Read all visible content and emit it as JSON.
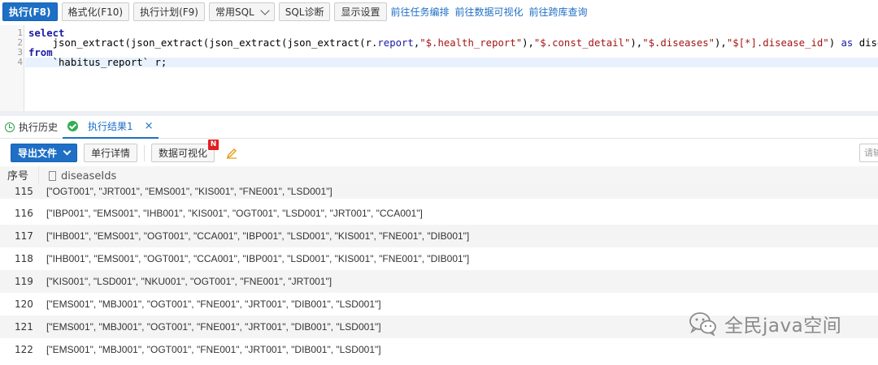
{
  "toolbar": {
    "execute": "执行(F8)",
    "format": "格式化(F10)",
    "plan": "执行计划(F9)",
    "common_sql": "常用SQL",
    "sql_diag": "SQL诊断",
    "display_settings": "显示设置",
    "link_task": "前往任务编排",
    "link_viz": "前往数据可视化",
    "link_cross": "前往跨库查询"
  },
  "editor": {
    "line_numbers": [
      "1",
      "2",
      "3",
      "4"
    ],
    "line1_kw": "select",
    "line2_a": "    json_extract(json_extract(json_extract(json_extract(r.",
    "line2_field": "report",
    "line2_b": ",",
    "line2_s1": "\"$.health_report\"",
    "line2_c": "),",
    "line2_s2": "\"$.const_detail\"",
    "line2_d": "),",
    "line2_s3": "\"$.diseases\"",
    "line2_e": "),",
    "line2_s4": "\"$[*].disease_id\"",
    "line2_f": ") ",
    "line2_as": "as",
    "line2_g": " diseaseIds",
    "line3_kw": "from",
    "line4": "    `habitus_report` r;"
  },
  "tabs": {
    "history": "执行历史",
    "result": "执行结果1",
    "close": "×"
  },
  "result_toolbar": {
    "export": "导出文件",
    "row_detail": "单行详情",
    "data_viz": "数据可视化",
    "new_badge": "N",
    "search_placeholder": "请输"
  },
  "grid": {
    "col_seq": "序号",
    "col_disease": "diseaseIds",
    "rows": [
      {
        "n": "115",
        "v": "[\"OGT001\", \"JRT001\", \"EMS001\", \"KIS001\", \"FNE001\", \"LSD001\"]"
      },
      {
        "n": "116",
        "v": "[\"IBP001\", \"EMS001\", \"IHB001\", \"KIS001\", \"OGT001\", \"LSD001\", \"JRT001\", \"CCA001\"]"
      },
      {
        "n": "117",
        "v": "[\"IHB001\", \"EMS001\", \"OGT001\", \"CCA001\", \"IBP001\", \"LSD001\", \"KIS001\", \"FNE001\", \"DIB001\"]"
      },
      {
        "n": "118",
        "v": "[\"IHB001\", \"EMS001\", \"OGT001\", \"CCA001\", \"IBP001\", \"LSD001\", \"KIS001\", \"FNE001\", \"DIB001\"]"
      },
      {
        "n": "119",
        "v": "[\"KIS001\", \"LSD001\", \"NKU001\", \"OGT001\", \"FNE001\", \"JRT001\"]"
      },
      {
        "n": "120",
        "v": "[\"EMS001\", \"MBJ001\", \"OGT001\", \"FNE001\", \"JRT001\", \"DIB001\", \"LSD001\"]"
      },
      {
        "n": "121",
        "v": "[\"EMS001\", \"MBJ001\", \"OGT001\", \"FNE001\", \"JRT001\", \"DIB001\", \"LSD001\"]"
      },
      {
        "n": "122",
        "v": "[\"EMS001\", \"MBJ001\", \"OGT001\", \"FNE001\", \"JRT001\", \"DIB001\", \"LSD001\"]"
      }
    ]
  },
  "watermark": {
    "text": "全民java空间",
    "icon": "wechat-icon"
  },
  "colors": {
    "accent": "#1e6fc5",
    "keyword": "#1a1aa6",
    "string": "#a31515",
    "success": "#2fae52"
  }
}
